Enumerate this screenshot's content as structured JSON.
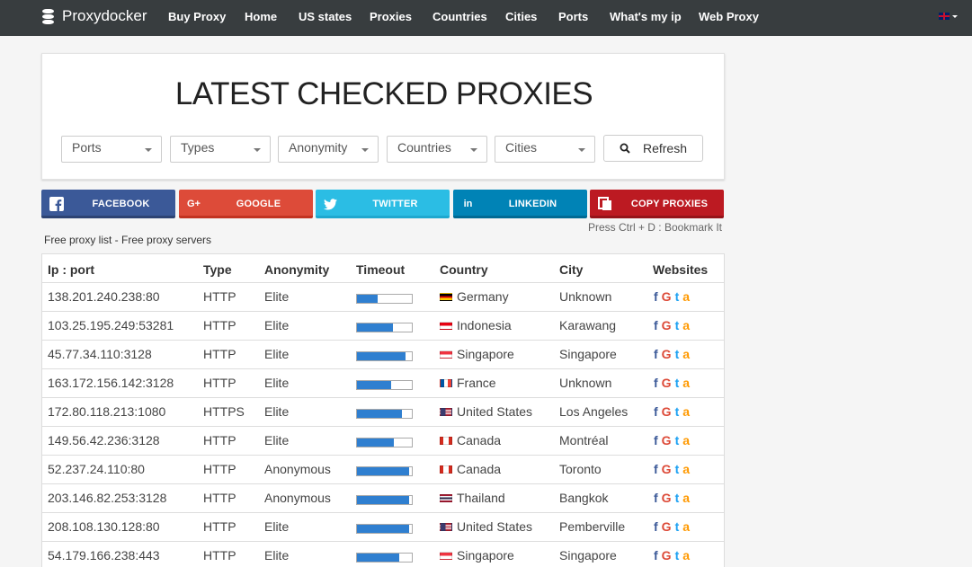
{
  "nav": {
    "brand": "Proxydocker",
    "links": [
      "Buy Proxy",
      "Home",
      "US states",
      "Proxies",
      "Countries",
      "Cities",
      "Ports",
      "What's my ip",
      "Web Proxy"
    ]
  },
  "header": {
    "title": "LATEST CHECKED PROXIES",
    "filters": [
      "Ports",
      "Types",
      "Anonymity",
      "Countries",
      "Cities"
    ],
    "refresh_label": "Refresh"
  },
  "share": {
    "facebook": "FACEBOOK",
    "google": "GOOGLE",
    "google_icon": "G+",
    "twitter": "TWITTER",
    "linkedin": "LINKEDIN",
    "linkedin_icon": "in",
    "copy": "COPY PROXIES"
  },
  "bookmark_hint": "Press Ctrl + D : Bookmark It",
  "caption": "Free proxy list - Free proxy servers",
  "table": {
    "headers": [
      "Ip : port",
      "Type",
      "Anonymity",
      "Timeout",
      "Country",
      "City",
      "Websites"
    ],
    "website_icons": {
      "facebook": "f",
      "google": "G",
      "twitter": "t",
      "amazon": "a"
    },
    "rows": [
      {
        "ip": "138.201.240.238:80",
        "type": "HTTP",
        "anonymity": "Elite",
        "timeout": 0.38,
        "flag": "de",
        "country": "Germany",
        "city": "Unknown"
      },
      {
        "ip": "103.25.195.249:53281",
        "type": "HTTP",
        "anonymity": "Elite",
        "timeout": 0.65,
        "flag": "id",
        "country": "Indonesia",
        "city": "Karawang"
      },
      {
        "ip": "45.77.34.110:3128",
        "type": "HTTP",
        "anonymity": "Elite",
        "timeout": 0.88,
        "flag": "sg",
        "country": "Singapore",
        "city": "Singapore"
      },
      {
        "ip": "163.172.156.142:3128",
        "type": "HTTP",
        "anonymity": "Elite",
        "timeout": 0.62,
        "flag": "fr",
        "country": "France",
        "city": "Unknown"
      },
      {
        "ip": "172.80.118.213:1080",
        "type": "HTTPS",
        "anonymity": "Elite",
        "timeout": 0.82,
        "flag": "us",
        "country": "United States",
        "city": "Los Angeles"
      },
      {
        "ip": "149.56.42.236:3128",
        "type": "HTTP",
        "anonymity": "Elite",
        "timeout": 0.67,
        "flag": "ca",
        "country": "Canada",
        "city": "Montréal"
      },
      {
        "ip": "52.237.24.110:80",
        "type": "HTTP",
        "anonymity": "Anonymous",
        "timeout": 0.95,
        "flag": "ca",
        "country": "Canada",
        "city": "Toronto"
      },
      {
        "ip": "203.146.82.253:3128",
        "type": "HTTP",
        "anonymity": "Anonymous",
        "timeout": 0.95,
        "flag": "th",
        "country": "Thailand",
        "city": "Bangkok"
      },
      {
        "ip": "208.108.130.128:80",
        "type": "HTTP",
        "anonymity": "Elite",
        "timeout": 0.95,
        "flag": "us",
        "country": "United States",
        "city": "Pemberville"
      },
      {
        "ip": "54.179.166.238:443",
        "type": "HTTP",
        "anonymity": "Elite",
        "timeout": 0.77,
        "flag": "sg",
        "country": "Singapore",
        "city": "Singapore"
      }
    ]
  },
  "colors": {
    "navbar": "#383d3f",
    "facebook": "#3b5998",
    "google": "#dd4b39",
    "twitter": "#2bbde4",
    "linkedin": "#0083b6",
    "copy": "#bc1a22",
    "timeout_bar": "#2f7fd0"
  }
}
